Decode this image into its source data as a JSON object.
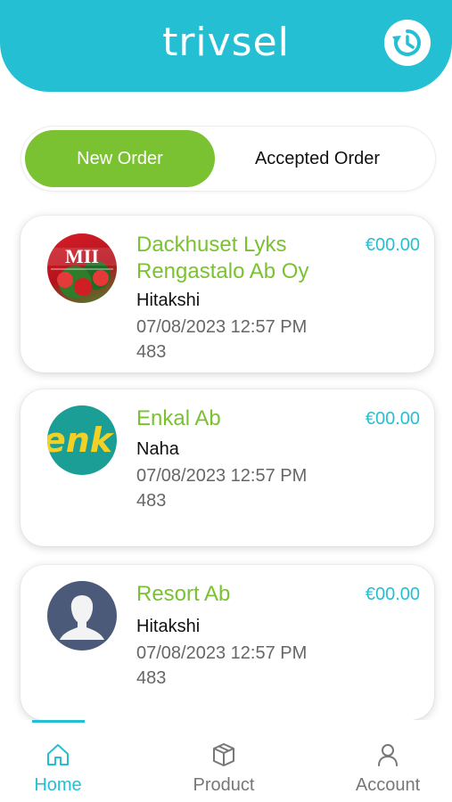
{
  "header": {
    "logo": "trivsel",
    "history_icon": "history-icon"
  },
  "tabs": {
    "new_order": "New Order",
    "accepted_order": "Accepted Order"
  },
  "orders": [
    {
      "company": "Dackhuset Lyks Rengastalo Ab Oy",
      "price": "€00.00",
      "person": "Hitakshi",
      "date": "07/08/2023 12:57 PM",
      "number": "483",
      "avatar_text": "MII"
    },
    {
      "company": "Enkal Ab",
      "price": "€00.00",
      "person": "Naha",
      "date": "07/08/2023 12:57 PM",
      "number": "483",
      "avatar_text": "enk"
    },
    {
      "company": "Resort Ab",
      "price": "€00.00",
      "person": "Hitakshi",
      "date": "07/08/2023 12:57 PM",
      "number": "483",
      "avatar_text": ""
    }
  ],
  "nav": {
    "home": "Home",
    "product": "Product",
    "account": "Account"
  },
  "colors": {
    "primary": "#25bfd4",
    "accent_green": "#7ac231",
    "active_nav": "#25bfd4",
    "inactive_nav": "#777777"
  }
}
